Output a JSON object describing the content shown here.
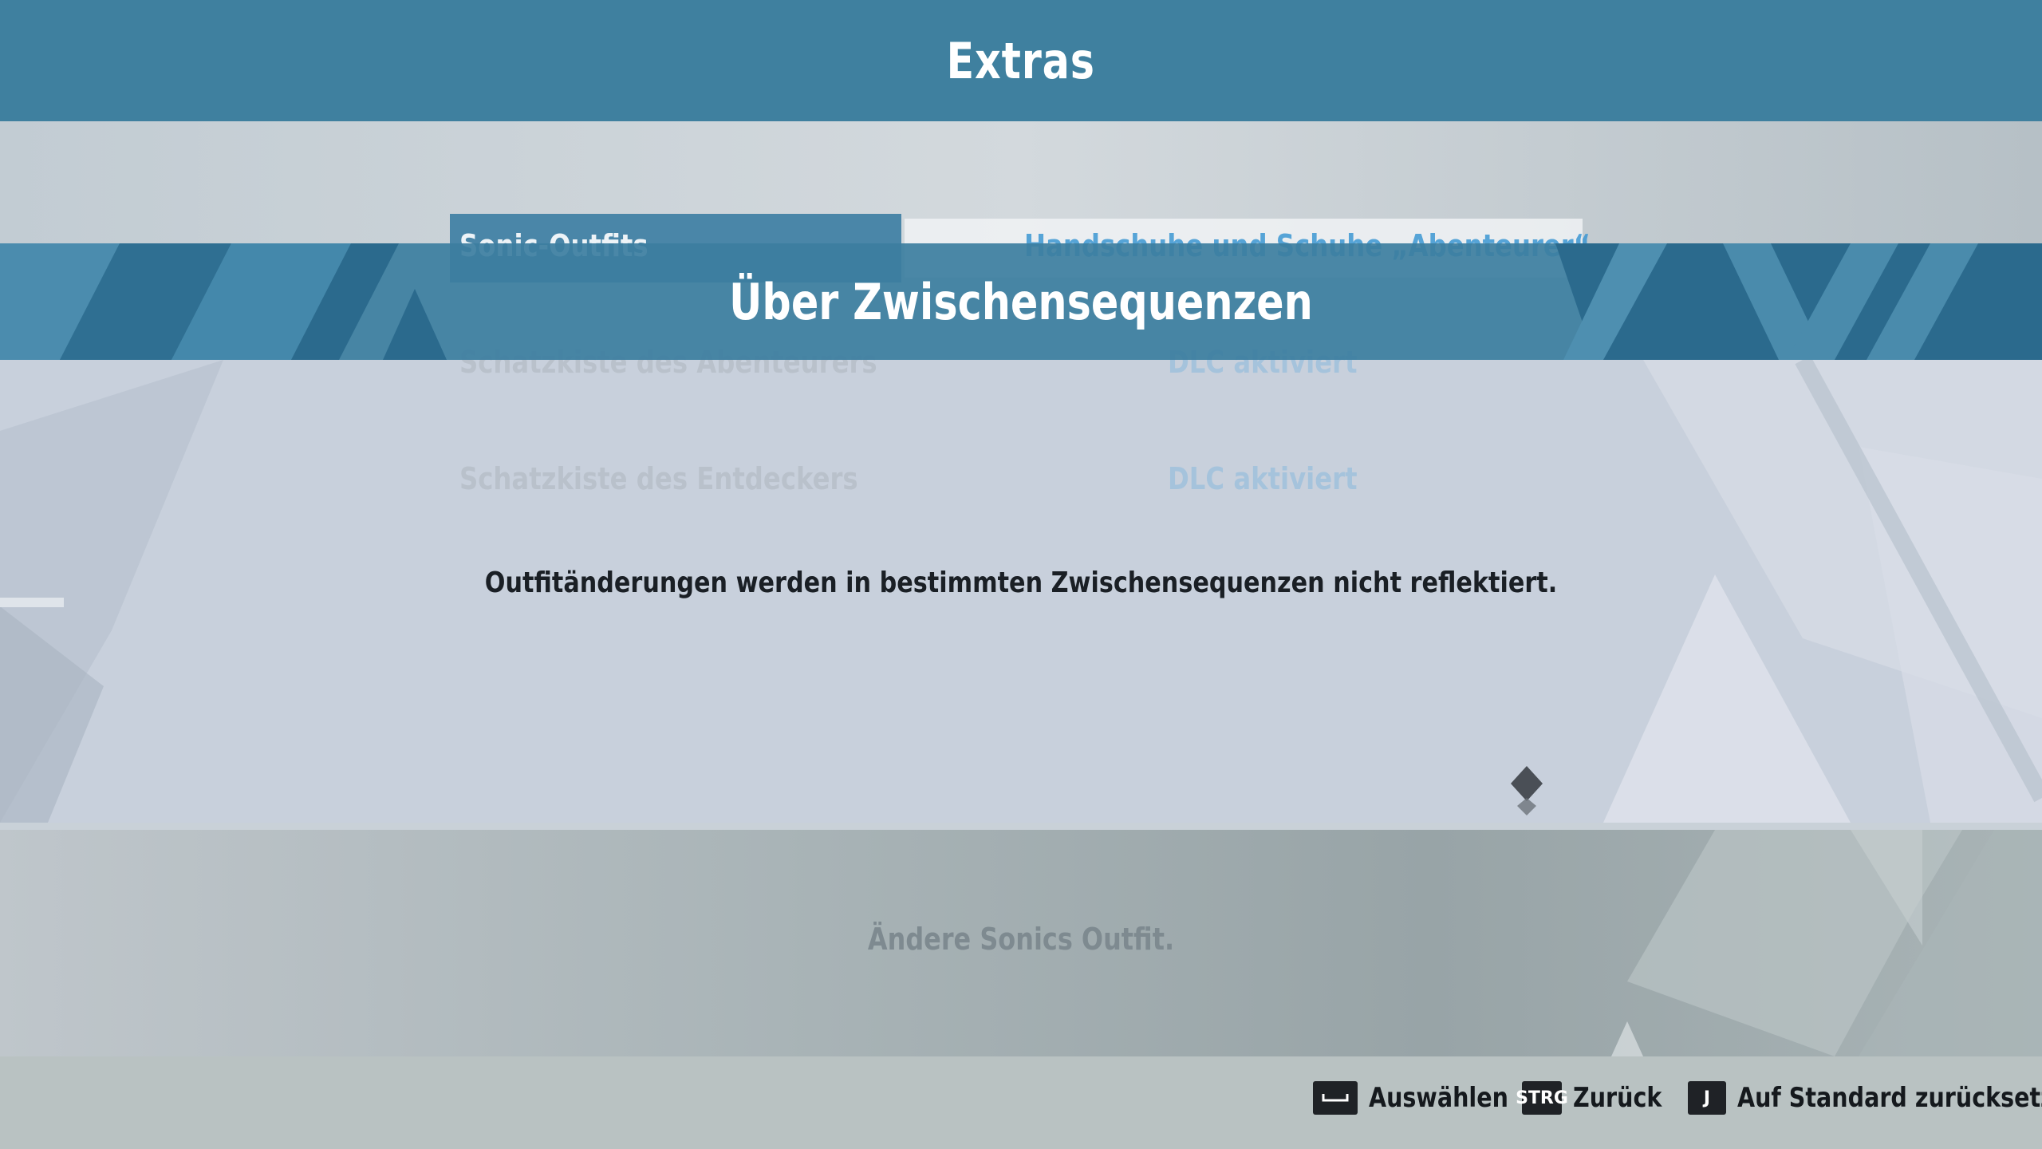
{
  "header": {
    "title": "Extras"
  },
  "menu": {
    "rows": [
      {
        "label": "Sonic-Outfits",
        "value": "Handschuhe und Schuhe „Abenteurer“"
      },
      {
        "label": "Schatzkiste des Abenteurers",
        "value": "DLC aktiviert"
      },
      {
        "label": "Schatzkiste des Entdeckers",
        "value": "DLC aktiviert"
      }
    ]
  },
  "dialog": {
    "title": "Über Zwischensequenzen",
    "message": "Outfitänderungen werden in bestimmten Zwischensequenzen nicht reflektiert."
  },
  "description": "Ändere Sonics Outfit.",
  "controls": [
    {
      "key": "",
      "label": "Auswählen"
    },
    {
      "key": "STRG",
      "label": "Zurück"
    },
    {
      "key": "J",
      "label": "Auf Standard zurücksetzen"
    }
  ],
  "colors": {
    "header": "#3f809f",
    "banner": "#2e6e8f",
    "dialog_text": "#1a1f25"
  }
}
